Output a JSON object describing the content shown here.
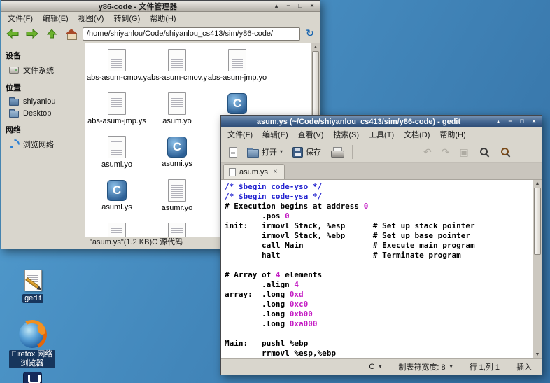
{
  "desktop": {
    "icons": [
      {
        "label": "gedit"
      },
      {
        "label": "Firefox 网络浏览器"
      }
    ]
  },
  "fm": {
    "title": "y86-code - 文件管理器",
    "menu": [
      "文件(F)",
      "编辑(E)",
      "视图(V)",
      "转到(G)",
      "帮助(H)"
    ],
    "address": "/home/shiyanlou/Code/shiyanlou_cs413/sim/y86-code/",
    "sidebar": [
      {
        "header": "设备",
        "items": [
          {
            "label": "文件系统",
            "icon": "drive-icon"
          }
        ]
      },
      {
        "header": "位置",
        "items": [
          {
            "label": "shiyanlou",
            "icon": "home-folder-icon"
          },
          {
            "label": "Desktop",
            "icon": "folder-icon"
          }
        ]
      },
      {
        "header": "网络",
        "items": [
          {
            "label": "浏览网络",
            "icon": "network-icon"
          }
        ]
      }
    ],
    "c_letter": "C",
    "files": [
      {
        "name": "abs-asum-cmov.yo",
        "type": "doc"
      },
      {
        "name": "abs-asum-cmov.ys",
        "type": "doc"
      },
      {
        "name": "abs-asum-jmp.yo",
        "type": "doc"
      },
      {
        "name": "abs-asum-jmp.ys",
        "type": "doc"
      },
      {
        "name": "asum.yo",
        "type": "doc"
      },
      {
        "name": "asum.ys",
        "type": "c"
      },
      {
        "name": "asumi.yo",
        "type": "doc"
      },
      {
        "name": "asumi.ys",
        "type": "c"
      },
      {
        "name": "",
        "type": "doc"
      },
      {
        "name": "asuml.ys",
        "type": "c"
      },
      {
        "name": "asumr.yo",
        "type": "doc"
      },
      {
        "name": "",
        "type": "doc"
      },
      {
        "name": "",
        "type": "doc"
      },
      {
        "name": "",
        "type": "doc"
      }
    ],
    "status": "\"asum.ys\"(1.2 KB)C 源代码"
  },
  "gedit": {
    "title": "asum.ys (~/Code/shiyanlou_cs413/sim/y86-code) - gedit",
    "menu": [
      "文件(F)",
      "编辑(E)",
      "查看(V)",
      "搜索(S)",
      "工具(T)",
      "文档(D)",
      "帮助(H)"
    ],
    "toolbar": {
      "open": "打开",
      "save": "保存"
    },
    "tab": "asum.ys",
    "status": {
      "lang": "C",
      "tabwidth": "制表符宽度: 8",
      "pos": "行 1,列 1",
      "mode": "插入"
    },
    "code": [
      [
        [
          "c",
          "/* $begin code-yso */"
        ]
      ],
      [
        [
          "c",
          "/* $begin code-ysa */"
        ]
      ],
      [
        [
          "p",
          "# Execution begins at address "
        ],
        [
          "n",
          "0"
        ]
      ],
      [
        [
          "p",
          "        .pos "
        ],
        [
          "n",
          "0"
        ]
      ],
      [
        [
          "p",
          "init:   irmovl Stack, %esp      # Set up stack pointer"
        ]
      ],
      [
        [
          "p",
          "        irmovl Stack, %ebp      # Set up base pointer"
        ]
      ],
      [
        [
          "p",
          "        call Main               # Execute main program"
        ]
      ],
      [
        [
          "p",
          "        halt                    # Terminate program"
        ]
      ],
      [],
      [
        [
          "p",
          "# Array of "
        ],
        [
          "n",
          "4"
        ],
        [
          "p",
          " elements"
        ]
      ],
      [
        [
          "p",
          "        .align "
        ],
        [
          "n",
          "4"
        ]
      ],
      [
        [
          "p",
          "array:  .long "
        ],
        [
          "n",
          "0xd"
        ]
      ],
      [
        [
          "p",
          "        .long "
        ],
        [
          "n",
          "0xc0"
        ]
      ],
      [
        [
          "p",
          "        .long "
        ],
        [
          "n",
          "0xb00"
        ]
      ],
      [
        [
          "p",
          "        .long "
        ],
        [
          "n",
          "0xa000"
        ]
      ],
      [],
      [
        [
          "p",
          "Main:   pushl %ebp"
        ]
      ],
      [
        [
          "p",
          "        rrmovl %esp,%ebp"
        ]
      ]
    ]
  }
}
